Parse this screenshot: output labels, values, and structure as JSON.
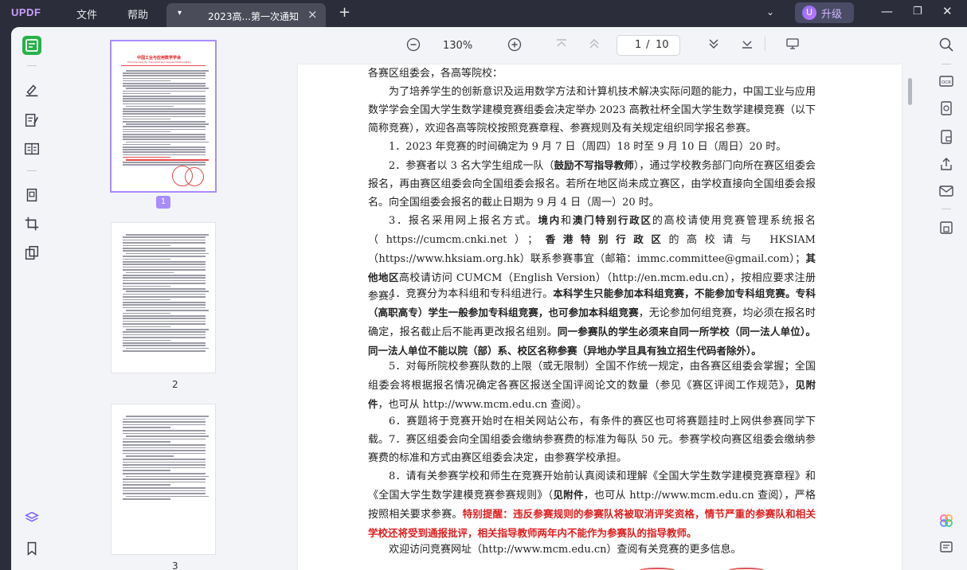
{
  "app": {
    "logo": "UPDF",
    "menu": [
      "文件",
      "帮助"
    ],
    "upgrade_label": "升级",
    "avatar_letter": "U"
  },
  "tab": {
    "title": "2023高...第一次通知",
    "close": "×",
    "add": "+"
  },
  "viewer": {
    "zoom": "130%",
    "current_page": "1",
    "separator": "/",
    "total_pages": "10"
  },
  "thumbnails": {
    "selected_badge": "1",
    "labels": [
      "2",
      "3"
    ]
  },
  "doc": {
    "p0": "各赛区组委会，各高等院校：",
    "p1": "为了培养学生的创新意识及运用数学方法和计算机技术解决实际问题的能力，中国工业与应用数学学会全国大学生数学建模竞赛组委会决定举办 2023 高教社杯全国大学生数学建模竞赛（以下简称竞赛），欢迎各高等院校按照竞赛章程、参赛规则及有关规定组织同学报名参赛。",
    "p2": "1．2023 年竞赛的时间确定为 9 月 7 日（周四）18 时至 9 月 10 日（周日）20 时。",
    "p3a": "2．参赛者以 3 名大学生组成一队（",
    "p3b": "鼓励不写指导教师",
    "p3c": "），通过学校教务部门向所在赛区组委会报名，再由赛区组委会向全国组委会报名。若所在地区尚未成立赛区，由学校直接向全国组委会报名。向全国组委会报名的截止日期为 9 月 4 日（周一）20 时。",
    "p4a": "3．报名采用网上报名方式。",
    "p4b": "境内",
    "p4c": "和",
    "p4d": "澳门特别行政区",
    "p4e": "的高校请使用竞赛管理系统报名（https://cumcm.cnki.net）；",
    "p4f": "香港特别行政区",
    "p4g": "的高校请与 HKSIAM（https://www.hksiam.org.hk）联系参赛事宜（邮箱：immc.committee@gmail.com）；",
    "p4h": "其他地区",
    "p4i": "高校请访问 CUMCM（English Version）（http://en.mcm.edu.cn），按相应要求注册参赛。",
    "p5a": "4．竞赛分为本科组和专科组进行。",
    "p5b": "本科学生只能参加本科组竞赛，不能参加专科组竞赛。专科（高职高专）学生一般参加专科组竞赛，也可参加本科组竞赛",
    "p5c": "，无论参加何组竞赛，均必须在报名时确定，报名截止后不能再更改报名组别。",
    "p5d": "同一参赛队的学生必须来自同一所学校（同一法人单位）。同一法人单位不能以院（部）系、校区名称参赛（异地办学且具有独立招生代码者除外）。",
    "p6a": "5．对每所院校参赛队数的上限（或无限制）全国不作统一规定，由各赛区组委会掌握；全国组委会将根据报名情况确定各赛区报送全国评阅论文的数量（参见《赛区评阅工作规范》，",
    "p6b": "见附件",
    "p6c": "，也可从 http://www.mcm.edu.cn 查阅）。",
    "p7": "6．赛题将于竞赛开始时在相关网站公布，有条件的赛区也可将赛题挂时上网供参赛同学下载。",
    "p8": "7．赛区组委会向全国组委会缴纳参赛费的标准为每队 50 元。参赛学校向赛区组委会缴纳参赛费的标准和方式由赛区组委会决定，由参赛学校承担。",
    "p9a": "8．请有关参赛学校和师生在竞赛开始前认真阅读和理解《全国大学生数学建模竞赛章程》和《全国大学生数学建模竞赛参赛规则》（",
    "p9b": "见附件",
    "p9c": "，也可从 http://www.mcm.edu.cn 查阅），严格按照相关要求参赛。",
    "p9d": "特别提醒：违反参赛规则的参赛队将被取消评奖资格，情节严重的参赛队和相关学校还将受到通报批评，相关指导教师两年内不能作为参赛队的指导教师。",
    "p10": "欢迎访问竞赛网址（http://www.mcm.edu.cn）查阅有关竞赛的更多信息。"
  },
  "thumb1": {
    "title_cn": "中国工业与应用数学学会",
    "title_en": "China Society for Industrial and Applied Mathematics"
  },
  "colors": {
    "accent": "#a98cff",
    "green": "#27b24a",
    "red": "#e01e1e"
  },
  "icons": [
    "reader-icon",
    "highlight-icon",
    "edit-text-icon",
    "form-icon",
    "organize-pages-icon",
    "crop-icon",
    "page-tools-icon",
    "layers-icon",
    "bookmark-icon",
    "search-icon",
    "ocr-icon",
    "convert-icon",
    "protect-icon",
    "share-icon",
    "email-icon",
    "save-icon",
    "ai-icon",
    "comment-icon"
  ]
}
